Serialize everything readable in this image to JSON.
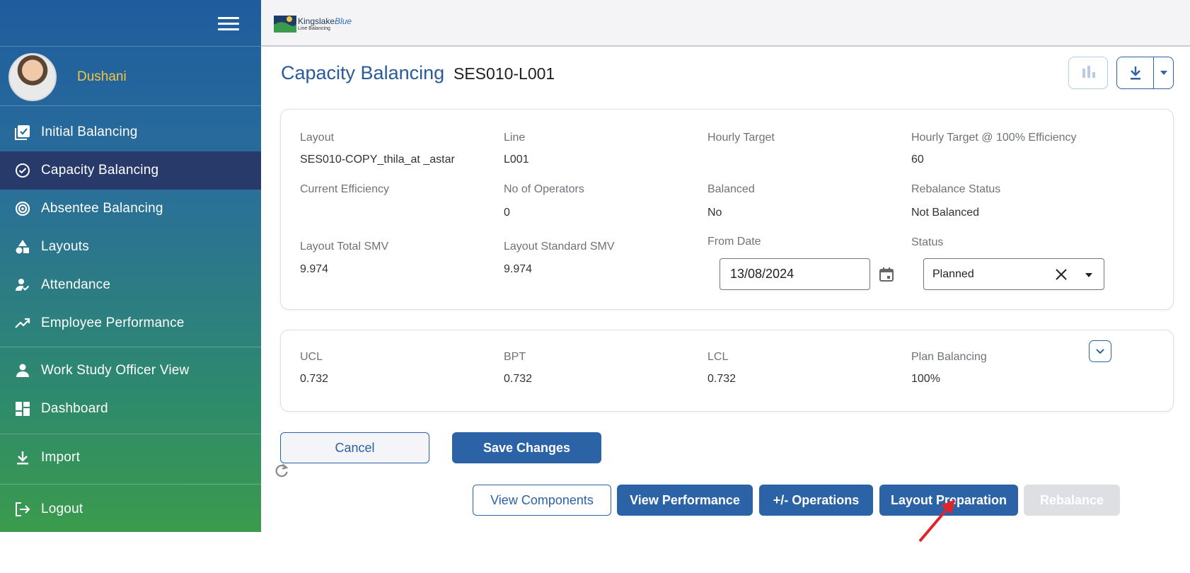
{
  "sidebar": {
    "user_name": "Dushani",
    "items": [
      {
        "label": "Initial Balancing",
        "icon": "checklist-icon"
      },
      {
        "label": "Capacity Balancing",
        "icon": "check-circle-icon"
      },
      {
        "label": "Absentee Balancing",
        "icon": "target-icon"
      },
      {
        "label": "Layouts",
        "icon": "shapes-icon"
      },
      {
        "label": "Attendance",
        "icon": "person-check-icon"
      },
      {
        "label": "Employee Performance",
        "icon": "trending-up-icon"
      },
      {
        "label": "Work Study Officer View",
        "icon": "person-icon"
      },
      {
        "label": "Dashboard",
        "icon": "dashboard-icon"
      },
      {
        "label": "Import",
        "icon": "download-icon"
      },
      {
        "label": "Logout",
        "icon": "logout-icon"
      }
    ]
  },
  "topbar": {
    "logo_name_a": "Kingslake",
    "logo_name_b": "Blue",
    "logo_sub": "Line Balancing"
  },
  "page": {
    "title": "Capacity Balancing",
    "code": "SES010-L001"
  },
  "details": {
    "layout_label": "Layout",
    "layout_value": "SES010-COPY_thila_at _astar",
    "line_label": "Line",
    "line_value": "L001",
    "hourly_target_label": "Hourly Target",
    "hourly_target_value": "",
    "hourly_target_100_label": "Hourly Target @ 100% Efficiency",
    "hourly_target_100_value": "60",
    "current_eff_label": "Current Efficiency",
    "current_eff_value": "",
    "operators_label": "No of Operators",
    "operators_value": "0",
    "balanced_label": "Balanced",
    "balanced_value": "No",
    "rebalance_status_label": "Rebalance Status",
    "rebalance_status_value": "Not Balanced",
    "total_smv_label": "Layout Total SMV",
    "total_smv_value": "9.974",
    "standard_smv_label": "Layout Standard SMV",
    "standard_smv_value": "9.974",
    "from_date_label": "From Date",
    "from_date_value": "13/08/2024",
    "status_label": "Status",
    "status_value": "Planned"
  },
  "limits": {
    "ucl_label": "UCL",
    "ucl_value": "0.732",
    "bpt_label": "BPT",
    "bpt_value": "0.732",
    "lcl_label": "LCL",
    "lcl_value": "0.732",
    "plan_label": "Plan Balancing",
    "plan_value": "100%"
  },
  "actions": {
    "cancel": "Cancel",
    "save": "Save Changes",
    "view_components": "View Components",
    "view_performance": "View Performance",
    "operations": "+/- Operations",
    "layout_preparation": "Layout Preparation",
    "rebalance": "Rebalance"
  },
  "colors": {
    "primary": "#2c62a6",
    "title_blue": "#285b97",
    "active_nav": "#283a6a",
    "user_name": "#f4c542",
    "annotation_arrow": "#e0252a"
  }
}
